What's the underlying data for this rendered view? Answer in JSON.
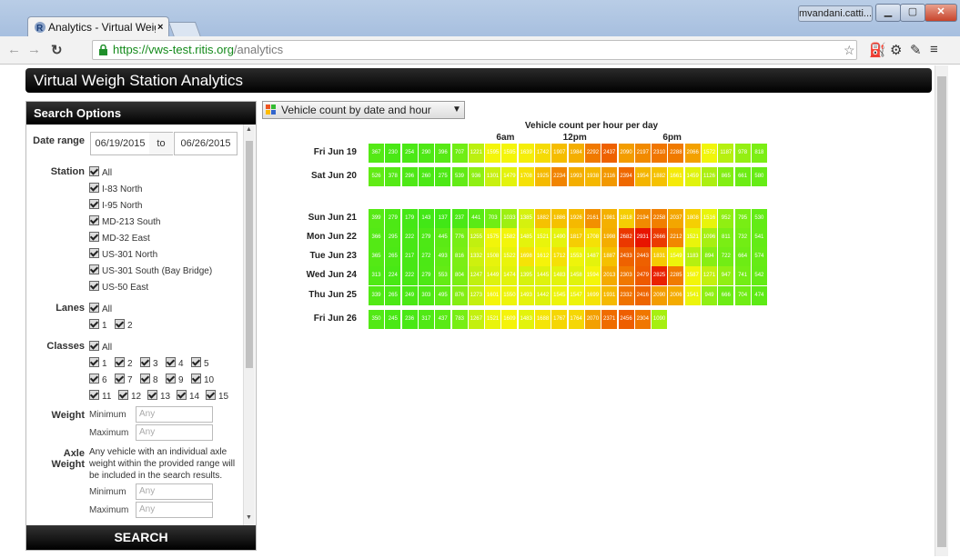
{
  "browser": {
    "tab_title": "Analytics - Virtual Weigh S",
    "tab_close": "×",
    "user": "mvandani.catti...",
    "url_host": "https://vws-test.ritis.org",
    "url_path": "/analytics"
  },
  "app": {
    "title": "Virtual Weigh Station Analytics"
  },
  "sidebar": {
    "heading": "Search Options",
    "date_range_label": "Date range",
    "date_from": "06/19/2015",
    "date_to_sep": "to",
    "date_to": "06/26/2015",
    "station_label": "Station",
    "stations": [
      "All",
      "I-83 North",
      "I-95 North",
      "MD-213 South",
      "MD-32 East",
      "US-301 North",
      "US-301 South (Bay Bridge)",
      "US-50 East"
    ],
    "lanes_label": "Lanes",
    "lanes_all": "All",
    "lanes": [
      "1",
      "2"
    ],
    "classes_label": "Classes",
    "classes_all": "All",
    "classes": [
      "1",
      "2",
      "3",
      "4",
      "5",
      "6",
      "7",
      "8",
      "9",
      "10",
      "11",
      "12",
      "13",
      "14",
      "15"
    ],
    "weight_label": "Weight",
    "weight_min_label": "Minimum",
    "weight_min_placeholder": "Any",
    "weight_max_label": "Maximum",
    "weight_max_placeholder": "Any",
    "axle_label": "Axle Weight",
    "axle_note": "Any vehicle with an individual axle weight within the provided range will be included in the search results.",
    "axle_min_label": "Minimum",
    "axle_min_placeholder": "Any",
    "axle_max_label": "Maximum",
    "axle_max_placeholder": "Any",
    "search_button": "SEARCH"
  },
  "main": {
    "view_select": "Vehicle count by date and hour",
    "heatmap_title": "Vehicle count per hour per day",
    "hour_labels": [
      "6am",
      "12pm",
      "6pm"
    ]
  },
  "chart_data": {
    "type": "heatmap",
    "title": "Vehicle count per hour per day",
    "x_tick_labels": [
      "6am",
      "12pm",
      "6pm"
    ],
    "rows": [
      {
        "day": "Fri Jun 19",
        "values": [
          367,
          230,
          254,
          290,
          396,
          707,
          1221,
          1595,
          1595,
          1639,
          1742,
          1907,
          1984,
          2292,
          2437,
          2090,
          2197,
          2310,
          2288,
          2066,
          1572,
          1187,
          978,
          818
        ]
      },
      {
        "day": "Sat Jun 20",
        "values": [
          526,
          378,
          296,
          260,
          275,
          539,
          936,
          1301,
          1479,
          1708,
          1925,
          2234,
          1993,
          1938,
          2116,
          2394,
          1954,
          1882,
          1661,
          1459,
          1126,
          865,
          661,
          580
        ]
      },
      {
        "day": "Sun Jun 21",
        "values": [
          399,
          279,
          179,
          143,
          137,
          237,
          441,
          703,
          1033,
          1385,
          1882,
          1886,
          1926,
          2161,
          1981,
          1818,
          2194,
          2258,
          2037,
          1808,
          1516,
          952,
          795,
          530
        ]
      },
      {
        "day": "Mon Jun 22",
        "values": [
          366,
          295,
          222,
          279,
          445,
          776,
          1255,
          1575,
          1582,
          1485,
          1521,
          1490,
          1817,
          1708,
          1998,
          2682,
          2931,
          2666,
          2212,
          1521,
          1096,
          811,
          732,
          541
        ]
      },
      {
        "day": "Tue Jun 23",
        "values": [
          365,
          265,
          217,
          272,
          493,
          816,
          1332,
          1508,
          1522,
          1698,
          1612,
          1712,
          1553,
          1487,
          1887,
          2433,
          2443,
          1831,
          1549,
          1183,
          894,
          722,
          664,
          574
        ]
      },
      {
        "day": "Wed Jun 24",
        "values": [
          313,
          224,
          222,
          279,
          553,
          804,
          1247,
          1449,
          1474,
          1395,
          1445,
          1483,
          1458,
          1594,
          2013,
          2303,
          2479,
          2825,
          2285,
          1587,
          1271,
          947,
          741,
          542
        ]
      },
      {
        "day": "Thu Jun 25",
        "values": [
          339,
          265,
          249,
          303,
          495,
          876,
          1273,
          1601,
          1550,
          1493,
          1442,
          1545,
          1547,
          1699,
          1931,
          2332,
          2416,
          2090,
          2006,
          1541,
          949,
          666,
          704,
          474
        ]
      },
      {
        "day": "Fri Jun 26",
        "values": [
          350,
          245,
          236,
          317,
          437,
          783,
          1267,
          1521,
          1609,
          1483,
          1688,
          1767,
          1764,
          2070,
          2371,
          2456,
          2304,
          1090
        ]
      }
    ],
    "color_scale": [
      "#36e516",
      "#aaee10",
      "#f5f50a",
      "#f5b800",
      "#f07a00",
      "#e81a00"
    ]
  }
}
